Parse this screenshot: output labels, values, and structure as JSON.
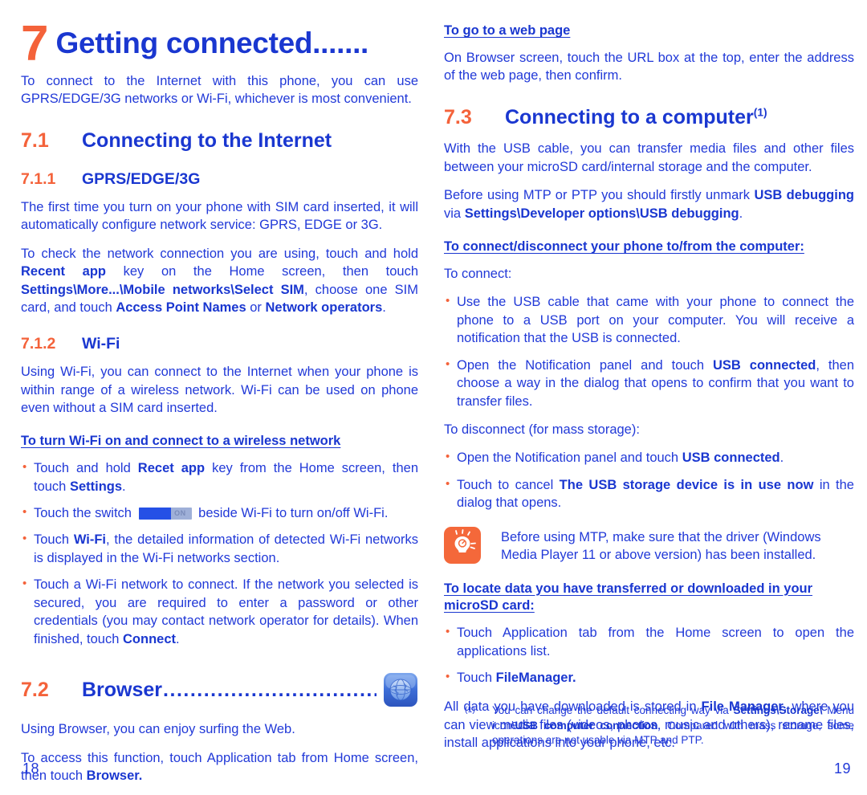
{
  "colors": {
    "blue_body": "#2139D8",
    "blue_heading": "#1A37D0",
    "orange": "#F4623A",
    "toggle_on": "#2550E6",
    "toggle_track": "#9FB0D8"
  },
  "left_page": {
    "chapter": {
      "number": "7",
      "title": "Getting connected......."
    },
    "intro": "To connect to the Internet with this phone, you can use GPRS/EDGE/3G networks or Wi-Fi, whichever is most convenient.",
    "section_71": {
      "number": "7.1",
      "title": "Connecting to the Internet"
    },
    "subsection_711": {
      "number": "7.1.1",
      "title": "GPRS/EDGE/3G",
      "para1": "The first time you turn on your phone with SIM card inserted, it will automatically configure network service: GPRS, EDGE or 3G.",
      "para2_part1": "To check the network connection you are using, touch and hold ",
      "para2_bold1": "Recent app",
      "para2_part2": " key on the Home screen, then touch ",
      "para2_bold2": "Settings\\More...\\Mobile networks\\Select SIM",
      "para2_part3": ", choose one SIM card, and touch ",
      "para2_bold3": "Access Point Names",
      "para2_part4": " or ",
      "para2_bold4": "Network operators",
      "para2_part5": "."
    },
    "subsection_712": {
      "number": "7.1.2",
      "title": "Wi-Fi",
      "para1": "Using Wi-Fi, you can connect to the Internet when your phone is within range of a wireless network. Wi-Fi can be used on phone even without a SIM card inserted.",
      "run_heading": "To turn Wi-Fi on and connect to a wireless network",
      "bullets": [
        {
          "id": "bullet-touch-hold-recent-app",
          "parts": [
            {
              "t": "Touch and hold ",
              "b": false
            },
            {
              "t": "Recet app",
              "b": true
            },
            {
              "t": " key from the Home screen, then touch ",
              "b": false
            },
            {
              "t": "Settings",
              "b": true
            },
            {
              "t": ".",
              "b": false
            }
          ]
        },
        {
          "id": "bullet-touch-switch",
          "switch_label": "ON",
          "parts": [
            {
              "t": "Touch the switch ",
              "b": false
            },
            {
              "t": "__SWITCH__",
              "b": false
            },
            {
              "t": " beside Wi-Fi to turn on/off Wi-Fi.",
              "b": false
            }
          ]
        },
        {
          "id": "bullet-touch-wifi",
          "parts": [
            {
              "t": "Touch ",
              "b": false
            },
            {
              "t": "Wi-Fi",
              "b": true
            },
            {
              "t": ", the detailed information of detected Wi-Fi networks is displayed in the Wi-Fi networks section.",
              "b": false
            }
          ]
        },
        {
          "id": "bullet-touch-network-connect",
          "parts": [
            {
              "t": "Touch a Wi-Fi network to connect. If the network you selected is secured, you are required to enter a password or other credentials (you may contact network operator for details). When finished, touch ",
              "b": false
            },
            {
              "t": "Connect",
              "b": true
            },
            {
              "t": ".",
              "b": false
            }
          ]
        }
      ]
    },
    "section_72": {
      "number": "7.2",
      "title": "Browser",
      "leader_dots": "......................................",
      "icon_name": "browser-globe-icon",
      "para1": "Using Browser, you can enjoy surfing the Web.",
      "para2_part1": "To access this function, touch Application tab from Home screen, then touch ",
      "para2_bold1": "Browser."
    },
    "page_number": "18"
  },
  "right_page": {
    "run_heading_webpage": "To go to a web page",
    "webpage_para": "On Browser screen, touch the URL box at the top, enter the address of the web page, then confirm.",
    "section_73": {
      "number": "7.3",
      "title": "Connecting to a computer",
      "footnote_marker": "(1)"
    },
    "para_usb_cable": "With the USB cable, you can transfer media files and other files between your microSD card/internal storage and the computer.",
    "para_mtp_part1": "Before using MTP or PTP you should firstly unmark ",
    "para_mtp_bold1": "USB debugging",
    "para_mtp_part2": " via ",
    "para_mtp_bold2": "Settings\\Developer options\\USB debugging",
    "para_mtp_part3": ".",
    "run_heading_connect": "To connect/disconnect your phone to/from the computer:",
    "label_to_connect": "To connect:",
    "connect_bullets": [
      {
        "id": "bullet-use-usb-cable",
        "parts": [
          {
            "t": "Use the USB cable that came with your phone to connect the phone to a USB port on your computer. You will receive a notification that the USB is connected.",
            "b": false
          }
        ]
      },
      {
        "id": "bullet-open-notification-panel",
        "parts": [
          {
            "t": "Open the Notification panel and touch ",
            "b": false
          },
          {
            "t": "USB connected",
            "b": true
          },
          {
            "t": ", then choose a way in the dialog that opens to confirm that you want to transfer files.",
            "b": false
          }
        ]
      }
    ],
    "label_to_disconnect": "To disconnect (for mass storage):",
    "disconnect_bullets": [
      {
        "id": "bullet-open-notification-panel-disconnect",
        "parts": [
          {
            "t": "Open the Notification panel and touch ",
            "b": false
          },
          {
            "t": "USB connected",
            "b": true
          },
          {
            "t": ".",
            "b": false
          }
        ]
      },
      {
        "id": "bullet-touch-to-cancel",
        "parts": [
          {
            "t": "Touch to cancel ",
            "b": false
          },
          {
            "t": "The USB storage device is in use now",
            "b": true
          },
          {
            "t": " in the dialog that opens.",
            "b": false
          }
        ]
      }
    ],
    "tip": {
      "icon_name": "lightbulb-tip-icon",
      "text": "Before using MTP, make sure that the driver (Windows Media Player 11 or above version) has been installed."
    },
    "run_heading_locate": "To locate data you have transferred or downloaded in your microSD card:",
    "locate_bullets": [
      {
        "id": "bullet-touch-application-tab",
        "parts": [
          {
            "t": "Touch Application tab from the Home screen to open the applications list.",
            "b": false
          }
        ]
      },
      {
        "id": "bullet-touch-filemanager",
        "parts": [
          {
            "t": "Touch ",
            "b": false
          },
          {
            "t": "FileManager.",
            "b": true
          }
        ]
      }
    ],
    "para_all_data_part1": "All data you have downloaded is stored in ",
    "para_all_data_bold1": "File Manager",
    "para_all_data_part2": ", where you can view media files (videos, photos, music and others), rename files, install applications into your phone, etc.",
    "footnote": {
      "marker": "(1)",
      "parts": [
        {
          "t": "You can change the default connecting way via ",
          "b": false
        },
        {
          "t": "Settings\\Storage\\",
          "b": true
        },
        {
          "t": " Menu icon\\",
          "b": false
        },
        {
          "t": "USB computer connection",
          "b": true
        },
        {
          "t": ". Compared with mass storage, some operations are not usable via MTP and PTP.",
          "b": false
        }
      ]
    },
    "page_number": "19"
  }
}
